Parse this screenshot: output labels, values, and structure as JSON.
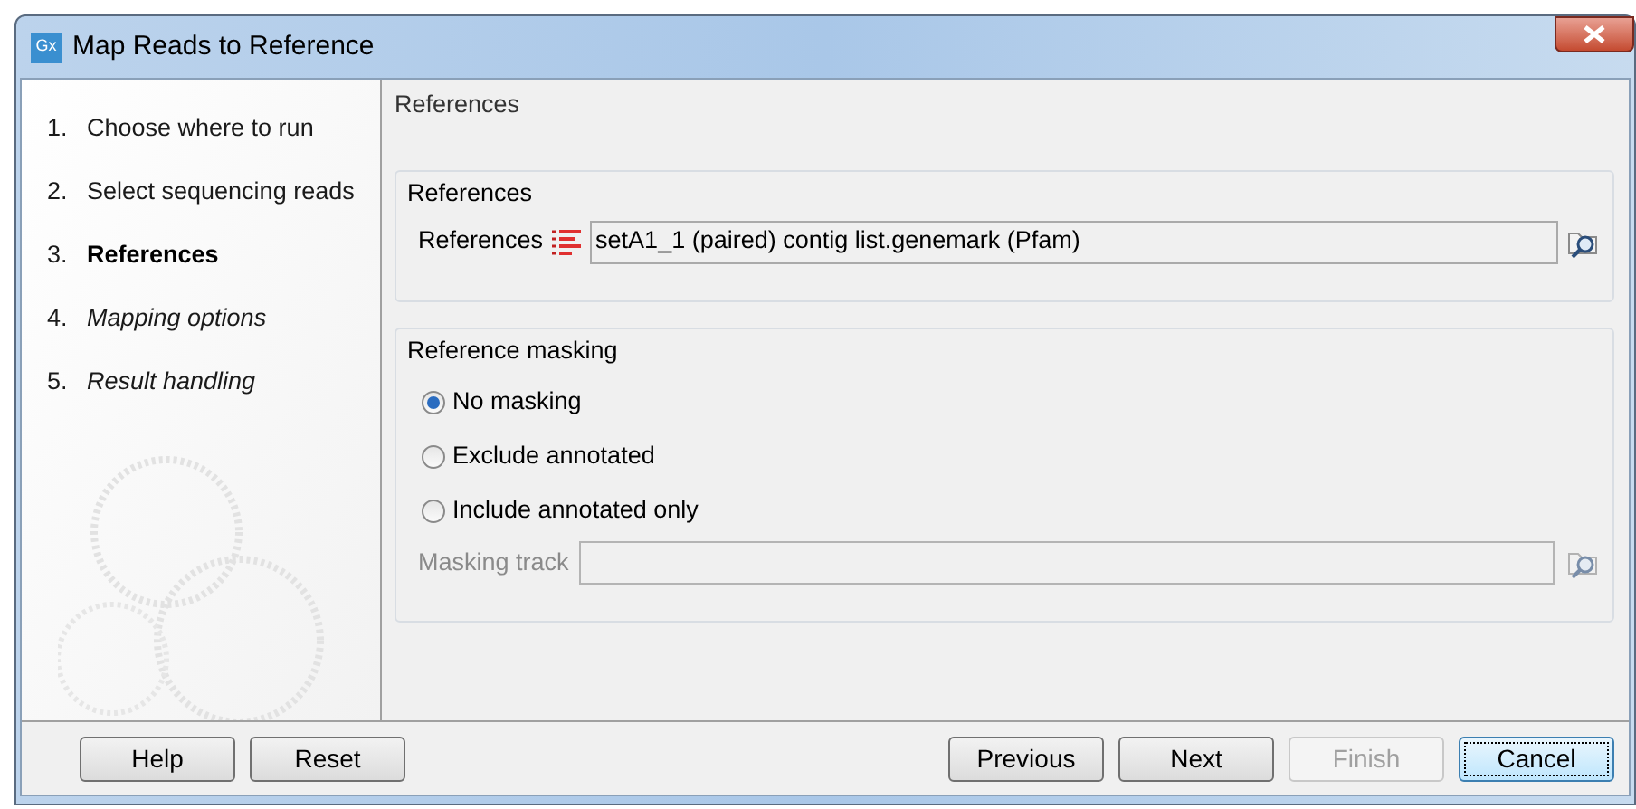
{
  "window": {
    "title": "Map Reads to Reference",
    "icon_text": "Gx"
  },
  "steps": [
    {
      "number": "1.",
      "label": "Choose where to run",
      "kind": "done"
    },
    {
      "number": "2.",
      "label": "Select sequencing reads",
      "kind": "done"
    },
    {
      "number": "3.",
      "label": "References",
      "kind": "current"
    },
    {
      "number": "4.",
      "label": "Mapping options",
      "kind": "pending"
    },
    {
      "number": "5.",
      "label": "Result handling",
      "kind": "pending"
    }
  ],
  "page_title": "References",
  "references_group": {
    "title": "References",
    "label": "References",
    "value": "setA1_1 (paired) contig list.genemark (Pfam)"
  },
  "masking_group": {
    "title": "Reference masking",
    "options": [
      {
        "label": "No masking",
        "selected": true
      },
      {
        "label": "Exclude annotated",
        "selected": false
      },
      {
        "label": "Include annotated only",
        "selected": false
      }
    ],
    "track": {
      "label": "Masking track",
      "disabled": true
    }
  },
  "buttons_left": [
    {
      "label": "Help",
      "disabled": false,
      "focused": false
    },
    {
      "label": "Reset",
      "disabled": false,
      "focused": false
    }
  ],
  "buttons_right": [
    {
      "label": "Previous",
      "disabled": false,
      "focused": false
    },
    {
      "label": "Next",
      "disabled": false,
      "focused": false
    },
    {
      "label": "Finish",
      "disabled": true,
      "focused": false
    },
    {
      "label": "Cancel",
      "disabled": false,
      "focused": true
    }
  ]
}
